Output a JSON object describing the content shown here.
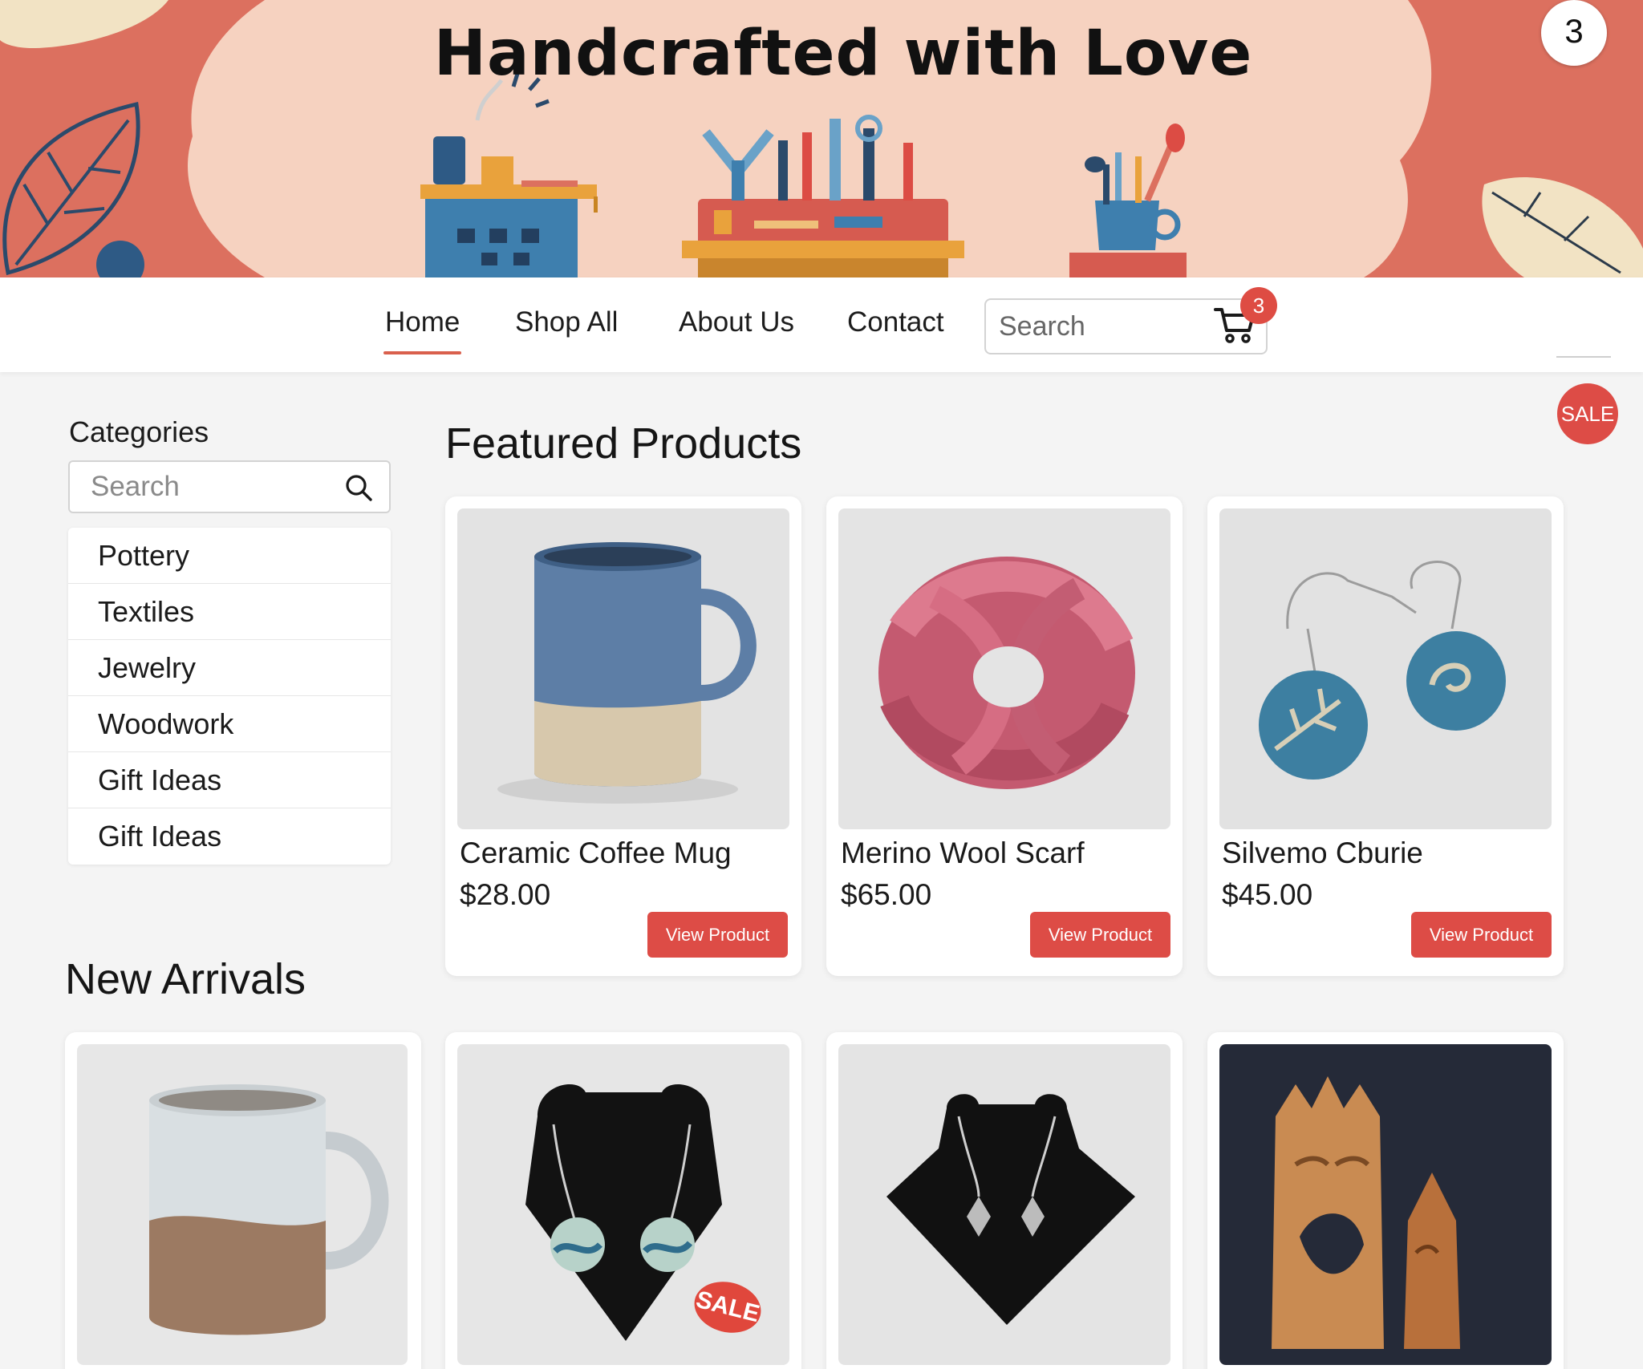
{
  "hero": {
    "title": "Handcrafted with Love",
    "corner_badge": "3"
  },
  "nav": {
    "links": [
      {
        "label": "Home",
        "active": true
      },
      {
        "label": "Shop All",
        "active": false
      },
      {
        "label": "About Us",
        "active": false
      },
      {
        "label": "Contact",
        "active": false
      }
    ],
    "search_placeholder": "Search",
    "cart_icon": "shopping-cart-icon",
    "cart_count": "3"
  },
  "floating_sale_label": "SALE",
  "sidebar": {
    "heading": "Categories",
    "search_placeholder": "Search",
    "search_icon": "magnifier-icon",
    "categories": [
      "Pottery",
      "Textiles",
      "Jewelry",
      "Woodwork",
      "Gift Ideas",
      "Gift Ideas"
    ]
  },
  "featured": {
    "title": "Featured Products",
    "products": [
      {
        "name": "Ceramic Coffee Mug",
        "price": "$28.00",
        "button": "View Product",
        "image": "blue-ceramic-mug"
      },
      {
        "name": "Merino Wool Scarf",
        "price": "$65.00",
        "button": "View Product",
        "image": "pink-knit-scarf"
      },
      {
        "name": "Silvemo Cburie",
        "price": "$45.00",
        "button": "View Product",
        "image": "blue-enamel-earrings"
      }
    ]
  },
  "new_arrivals": {
    "title": "New Arrivals",
    "items": [
      {
        "image": "speckled-stoneware-mug"
      },
      {
        "image": "ocean-pendant-necklace",
        "badge": "SALE"
      },
      {
        "image": "silver-leaf-necklace"
      },
      {
        "image": "carved-wood-figures"
      }
    ]
  },
  "colors": {
    "accent": "#dd4c46",
    "hero_coral": "#dc705f",
    "hero_peach": "#f6d2c0",
    "page_bg": "#f4f4f4"
  }
}
